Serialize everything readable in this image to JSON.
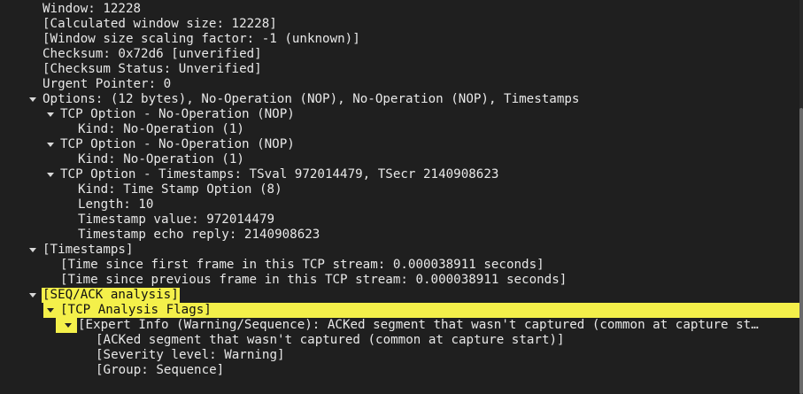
{
  "rows": [
    {
      "text": "Window: 12228",
      "indent": 2,
      "toggle": "none"
    },
    {
      "text": "[Calculated window size: 12228]",
      "indent": 2,
      "toggle": "none"
    },
    {
      "text": "[Window size scaling factor: -1 (unknown)]",
      "indent": 2,
      "toggle": "none"
    },
    {
      "text": "Checksum: 0x72d6 [unverified]",
      "indent": 2,
      "toggle": "none"
    },
    {
      "text": "[Checksum Status: Unverified]",
      "indent": 2,
      "toggle": "none"
    },
    {
      "text": "Urgent Pointer: 0",
      "indent": 2,
      "toggle": "none"
    },
    {
      "text": "Options: (12 bytes), No-Operation (NOP), No-Operation (NOP), Timestamps",
      "indent": 2,
      "toggle": "expanded"
    },
    {
      "text": "TCP Option - No-Operation (NOP)",
      "indent": 3,
      "toggle": "expanded"
    },
    {
      "text": "Kind: No-Operation (1)",
      "indent": 4,
      "toggle": "none"
    },
    {
      "text": "TCP Option - No-Operation (NOP)",
      "indent": 3,
      "toggle": "expanded"
    },
    {
      "text": "Kind: No-Operation (1)",
      "indent": 4,
      "toggle": "none"
    },
    {
      "text": "TCP Option - Timestamps: TSval 972014479, TSecr 2140908623",
      "indent": 3,
      "toggle": "expanded"
    },
    {
      "text": "Kind: Time Stamp Option (8)",
      "indent": 4,
      "toggle": "none"
    },
    {
      "text": "Length: 10",
      "indent": 4,
      "toggle": "none"
    },
    {
      "text": "Timestamp value: 972014479",
      "indent": 4,
      "toggle": "none"
    },
    {
      "text": "Timestamp echo reply: 2140908623",
      "indent": 4,
      "toggle": "none"
    },
    {
      "text": "[Timestamps]",
      "indent": 2,
      "toggle": "expanded"
    },
    {
      "text": "[Time since first frame in this TCP stream: 0.000038911 seconds]",
      "indent": 3,
      "toggle": "none"
    },
    {
      "text": "[Time since previous frame in this TCP stream: 0.000038911 seconds]",
      "indent": 3,
      "toggle": "none"
    },
    {
      "text": "[SEQ/ACK analysis]",
      "indent": 2,
      "toggle": "expanded",
      "highlight": "label-only"
    },
    {
      "text": "[TCP Analysis Flags]",
      "indent": 3,
      "toggle": "expanded",
      "highlight": "full"
    },
    {
      "text": "[Expert Info (Warning/Sequence): ACKed segment that wasn't captured (common at capture st…",
      "indent": 4,
      "toggle": "expanded",
      "highlight": "bar"
    },
    {
      "text": "[ACKed segment that wasn't captured (common at capture start)]",
      "indent": 5,
      "toggle": "none"
    },
    {
      "text": "[Severity level: Warning]",
      "indent": 5,
      "toggle": "none"
    },
    {
      "text": "[Group: Sequence]",
      "indent": 5,
      "toggle": "none"
    }
  ],
  "colors": {
    "background": "#1f1f1f",
    "text": "#e8e8e8",
    "highlight": "#f4f04a",
    "highlight_text": "#111111"
  },
  "icons": {
    "expanded": "chevron-down-icon"
  }
}
